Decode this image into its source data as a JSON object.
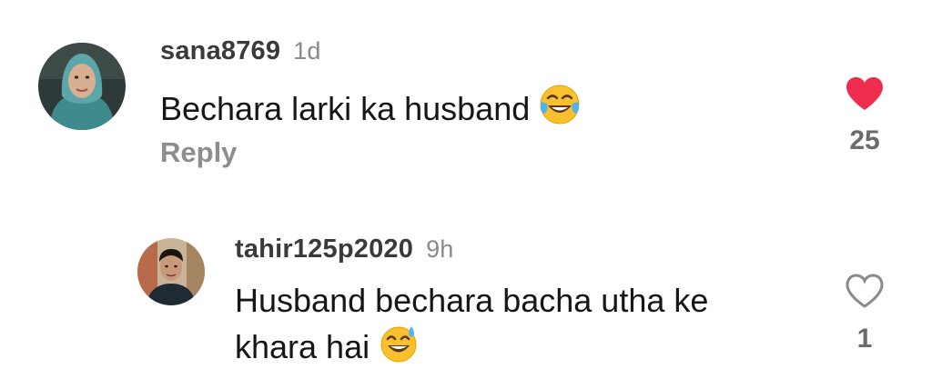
{
  "comments": [
    {
      "username": "sana8769",
      "time": "1d",
      "text": "Bechara larki ka husband",
      "emoji": "face-with-tears-of-joy",
      "reply_label": "Reply",
      "likes": "25",
      "liked": true,
      "like_color": "#ee2d4f"
    },
    {
      "username": "tahir125p2020",
      "time": "9h",
      "text_line1": "Husband bechara bacha utha ke",
      "text_line2": "khara hai",
      "emoji": "grinning-face-with-sweat",
      "likes": "1",
      "liked": false,
      "like_color": "#8a8a8a"
    }
  ]
}
